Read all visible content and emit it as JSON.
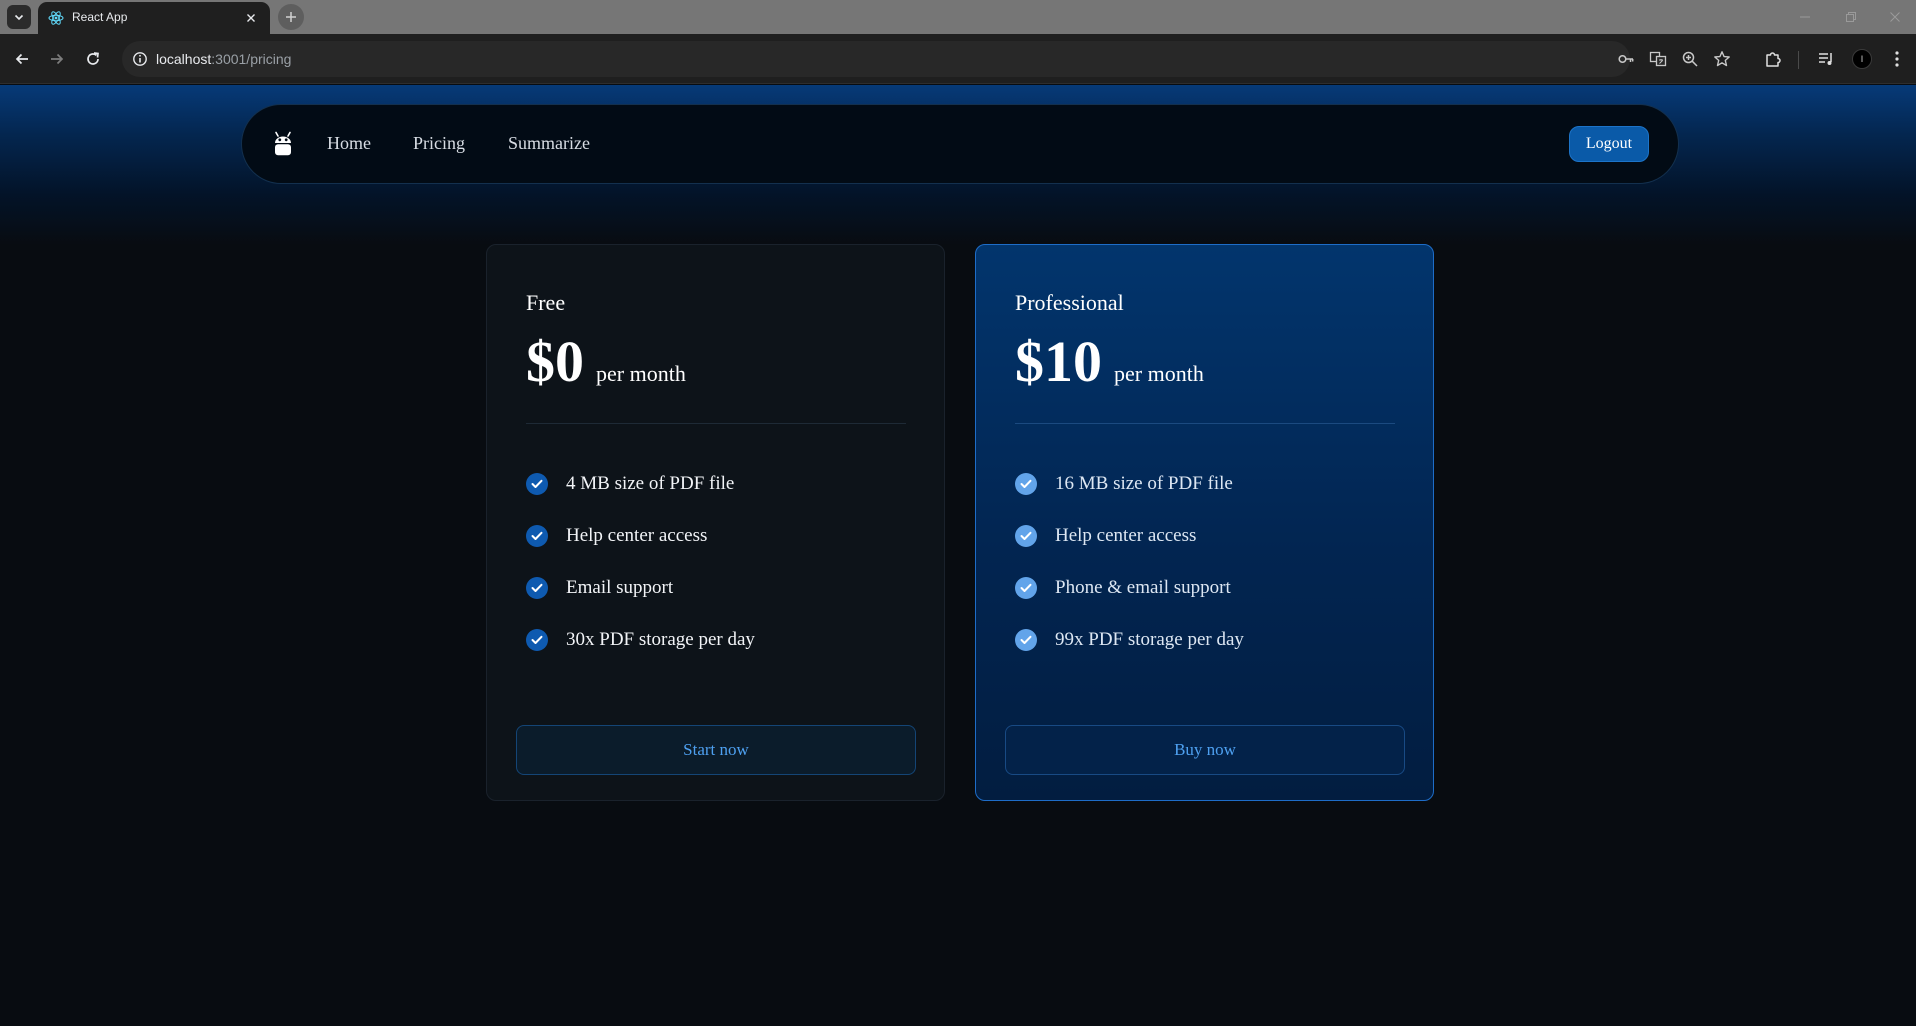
{
  "browser": {
    "tab_title": "React App",
    "url_host": "localhost",
    "url_rest": ":3001/pricing",
    "profile_initial": "I"
  },
  "navbar": {
    "links": [
      "Home",
      "Pricing",
      "Summarize"
    ],
    "logout_label": "Logout"
  },
  "plans": [
    {
      "name": "Free",
      "price": "$0",
      "period": "per month",
      "features": [
        "4 MB size of PDF file",
        "Help center access",
        "Email support",
        "30x PDF storage per day"
      ],
      "cta": "Start now"
    },
    {
      "name": "Professional",
      "price": "$10",
      "period": "per month",
      "features": [
        "16 MB size of PDF file",
        "Help center access",
        "Phone & email support",
        "99x PDF storage per day"
      ],
      "cta": "Buy now"
    }
  ],
  "colors": {
    "accent": "#0a5aa8",
    "link_blue": "#4ea0f0",
    "page_bg": "#080c11",
    "pro_card_border": "#1e6dc8"
  },
  "icons": [
    "react-favicon-icon",
    "close-icon",
    "plus-icon",
    "back-icon",
    "forward-icon",
    "reload-icon",
    "site-info-icon",
    "key-icon",
    "translate-icon",
    "zoom-icon",
    "star-icon",
    "extensions-icon",
    "media-icon",
    "menu-dots-icon",
    "robot-logo-icon",
    "check-icon"
  ]
}
